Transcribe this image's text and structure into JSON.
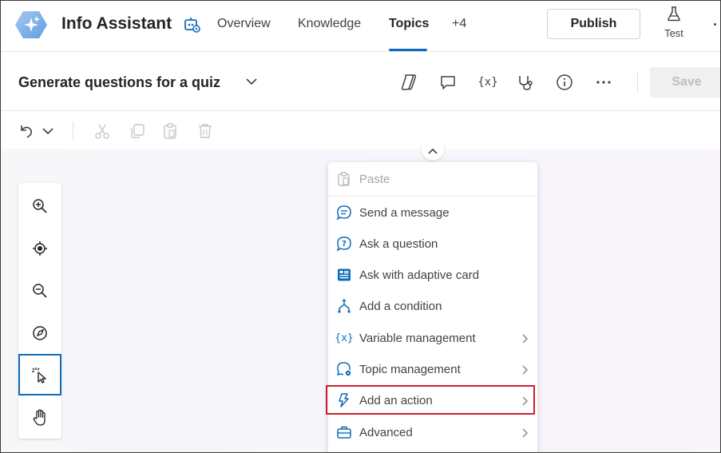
{
  "header": {
    "app_title": "Info Assistant",
    "tabs": [
      {
        "label": "Overview"
      },
      {
        "label": "Knowledge"
      },
      {
        "label": "Topics"
      },
      {
        "label": "+4"
      }
    ],
    "active_tab": "Topics",
    "publish_label": "Publish",
    "test_label": "Test"
  },
  "topic": {
    "title": "Generate questions for a quiz",
    "save_label": "Save"
  },
  "menu": {
    "items": [
      {
        "label": "Paste",
        "icon": "paste-icon",
        "disabled": true,
        "submenu": false
      },
      {
        "label": "Send a message",
        "icon": "message-icon",
        "disabled": false,
        "submenu": false
      },
      {
        "label": "Ask a question",
        "icon": "question-icon",
        "disabled": false,
        "submenu": false
      },
      {
        "label": "Ask with adaptive card",
        "icon": "adaptive-card-icon",
        "disabled": false,
        "submenu": false
      },
      {
        "label": "Add a condition",
        "icon": "condition-icon",
        "disabled": false,
        "submenu": false
      },
      {
        "label": "Variable management",
        "icon": "variable-icon",
        "disabled": false,
        "submenu": true
      },
      {
        "label": "Topic management",
        "icon": "topic-management-icon",
        "disabled": false,
        "submenu": true
      },
      {
        "label": "Add an action",
        "icon": "action-icon",
        "disabled": false,
        "submenu": true,
        "highlighted": true
      },
      {
        "label": "Advanced",
        "icon": "briefcase-icon",
        "disabled": false,
        "submenu": true
      }
    ]
  },
  "colors": {
    "accent": "#0f6cbd",
    "highlight": "#d11f2a",
    "icon_blue": "#0f6cbd"
  }
}
